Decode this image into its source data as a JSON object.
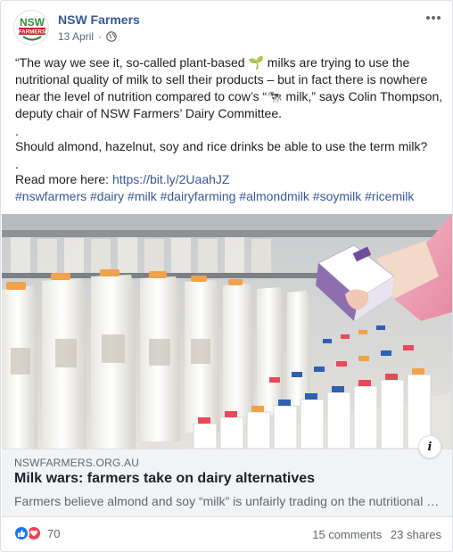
{
  "header": {
    "page_name": "NSW Farmers",
    "date": "13 April",
    "separator": "·",
    "avatar_text_top": "NSW",
    "avatar_text_bottom": "FARMERS"
  },
  "post": {
    "paragraph1": "“The way we see it, so-called plant-based 🌱 milks are trying to use the nutritional quality of milk to sell their products – but in fact there is nowhere near the level of nutrition compared to cow’s “🐄 milk,” says Colin Thompson, deputy chair of NSW Farmers’ Dairy Committee.",
    "dot1": ".",
    "paragraph2": "Should almond, hazelnut, soy and rice drinks be able to use the term milk?",
    "dot2": ".",
    "read_more_label": "Read more here: ",
    "read_more_link": "https://bit.ly/2UaahJZ",
    "hashtags": "#nswfarmers #dairy #milk #dairyfarming #almondmilk #soymilk #ricemilk"
  },
  "preview": {
    "domain": "NSWFARMERS.ORG.AU",
    "title": "Milk wars: farmers take on dairy alternatives",
    "description": "Farmers believe almond and soy “milk” is unfairly trading on the nutritional value of milk",
    "info": "i"
  },
  "footer": {
    "reaction_count": "70",
    "comments": "15 comments",
    "shares": "23 shares"
  },
  "colors": {
    "link": "#385898",
    "like": "#1877f2",
    "love": "#f33e58",
    "logo_green": "#2f8f3a",
    "logo_red": "#c8202f"
  },
  "icons": [
    "globe-icon",
    "more-options-icon",
    "info-icon",
    "like-reaction-icon",
    "love-reaction-icon"
  ]
}
